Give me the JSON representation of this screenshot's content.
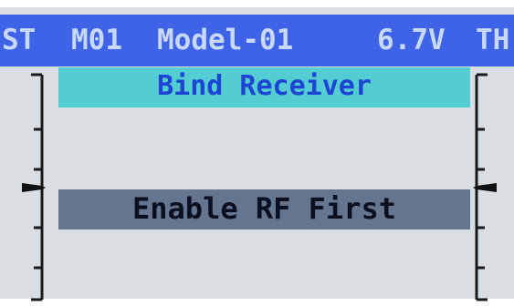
{
  "status_bar": {
    "st_label": "ST",
    "model_number": "M01",
    "model_name": "Model-01",
    "battery_voltage": "6.7V",
    "th_label": "TH"
  },
  "screen": {
    "title": "Bind Receiver",
    "message": "Enable RF First"
  },
  "trims": {
    "steering": {
      "label": "ST",
      "position": 0.5
    },
    "throttle": {
      "label": "TH",
      "position": 0.5
    }
  },
  "colors": {
    "status_bar_bg": "#3f63e6",
    "status_text": "#c7d9ff",
    "title_bg": "#53ccd2",
    "title_text": "#1d44d2",
    "message_bg": "#64758f",
    "message_text": "#0b1020",
    "screen_bg": "#d9dee2"
  }
}
